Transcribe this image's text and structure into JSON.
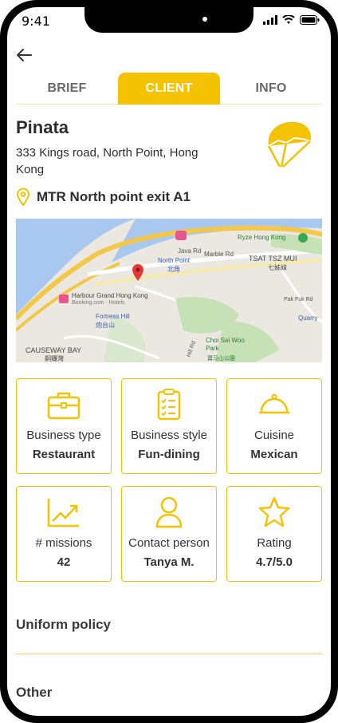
{
  "status": {
    "time": "9:41"
  },
  "tabs": [
    {
      "label": "BRIEF",
      "active": false
    },
    {
      "label": "CLIENT",
      "active": true
    },
    {
      "label": "INFO",
      "active": false
    }
  ],
  "client": {
    "name": "Pinata",
    "address": "333 Kings road, North Point, Hong Kong",
    "mtr": "MTR North point exit A1"
  },
  "map": {
    "labels": [
      "Java Rd",
      "Marble Rd",
      "North Point",
      "北角",
      "Ryze Hong Kong",
      "TSAT TSZ MUI",
      "七姊妹",
      "Harbour Grand Hong Kong",
      "Booking.com · Hotels",
      "Fortress Hill",
      "炮台山",
      "Pak Fuk Rd",
      "Quarry",
      "CAUSEWAY BAY",
      "銅鑼灣",
      "Choi Sai Woo Park",
      "寶马山公園",
      "Hill Rd"
    ]
  },
  "details": [
    {
      "label": "Business type",
      "value": "Restaurant",
      "icon": "briefcase-icon"
    },
    {
      "label": "Business style",
      "value": "Fun-dining",
      "icon": "clipboard-checklist-icon"
    },
    {
      "label": "Cuisine",
      "value": "Mexican",
      "icon": "cloche-icon"
    },
    {
      "label": "# missions",
      "value": "42",
      "icon": "trend-up-icon"
    },
    {
      "label": "Contact person",
      "value": "Tanya M.",
      "icon": "person-icon"
    },
    {
      "label": "Rating",
      "value": "4.7/5.0",
      "icon": "star-icon"
    }
  ],
  "sections": {
    "uniform": "Uniform policy",
    "other": "Other"
  },
  "colors": {
    "accent": "#f5c200",
    "text": "#2d2d2d",
    "muted": "#6a6a6a"
  }
}
